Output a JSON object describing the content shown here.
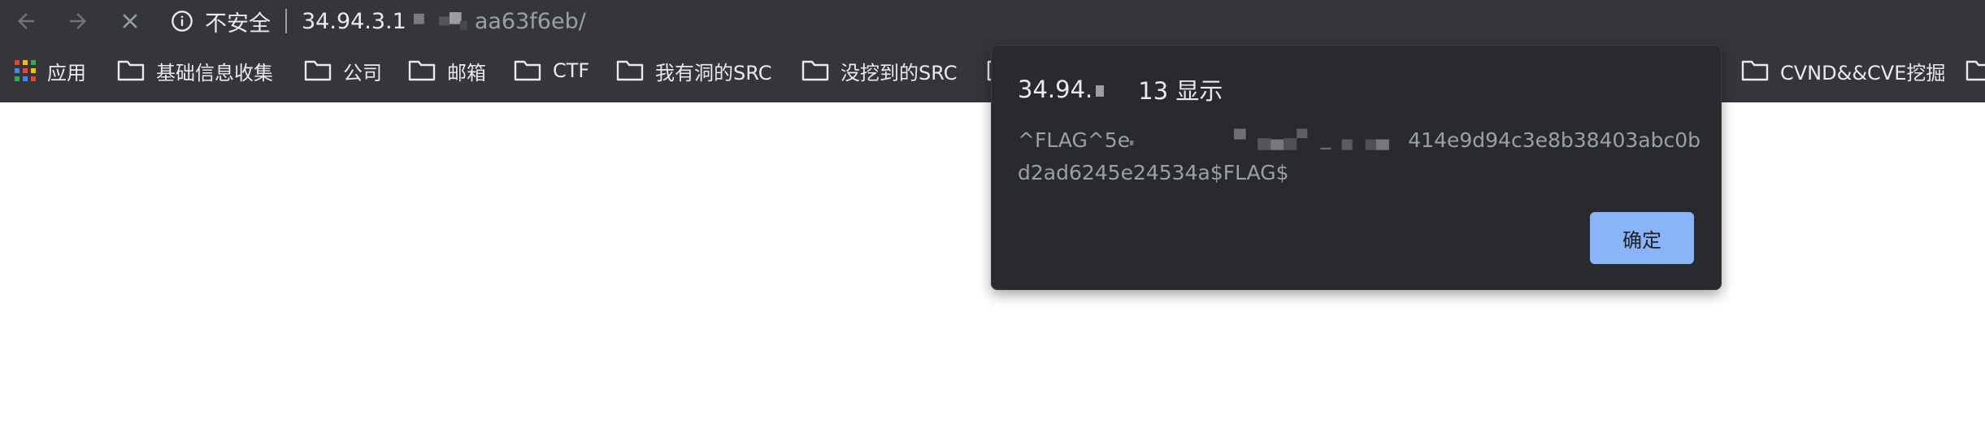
{
  "toolbar": {
    "back_icon": "arrow-left-icon",
    "forward_icon": "arrow-right-icon",
    "stop_icon": "close-icon"
  },
  "omnibox": {
    "info_icon": "info-icon",
    "security_label": "不安全",
    "url_prefix": "34.94.3.1",
    "url_suffix": "aa63f6eb/"
  },
  "bookmarks": {
    "apps_label": "应用",
    "items": [
      {
        "label": "基础信息收集"
      },
      {
        "label": "公司"
      },
      {
        "label": "邮箱"
      },
      {
        "label": "CTF"
      },
      {
        "label": "我有洞的SRC"
      },
      {
        "label": "没挖到的SRC"
      },
      {
        "label": "CVND&&CVE挖掘"
      }
    ]
  },
  "dialog": {
    "title_prefix": "34.94.",
    "title_suffix": "13 显示",
    "message_line1_prefix": "^FLAG^5e",
    "message_line1_suffix": "414e9d94c3e8b38403abc0b",
    "message_line2": "d2ad6245e24534a$FLAG$",
    "ok_label": "确定"
  },
  "colors": {
    "chrome_bg": "#35363a",
    "dialog_bg": "#292a2d",
    "button_bg": "#8ab4f8",
    "text_primary": "#e8eaed",
    "text_secondary": "#9aa0a6"
  }
}
